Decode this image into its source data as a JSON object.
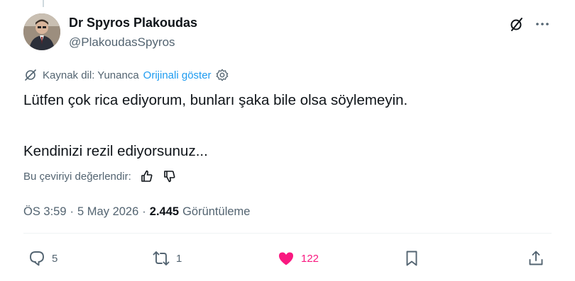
{
  "author": {
    "name": "Dr Spyros Plakoudas",
    "handle": "@PlakoudasSpyros"
  },
  "translation": {
    "source_label": "Kaynak dil: Yunanca",
    "show_original": "Orijinali göster"
  },
  "tweet": {
    "line1": "Lütfen çok rica ediyorum, bunları şaka bile olsa söylemeyin.",
    "line2": "Kendinizi rezil ediyorsunuz..."
  },
  "rate": {
    "label": "Bu çeviriyi değerlendir:"
  },
  "meta": {
    "time": "ÖS 3:59",
    "separator": "·",
    "date": "5 May 2026",
    "views_count": "2.445",
    "views_label": "Görüntüleme"
  },
  "actions": {
    "reply_count": "5",
    "retweet_count": "1",
    "like_count": "122"
  },
  "colors": {
    "text": "#0f1419",
    "muted": "#536471",
    "link": "#1d9bf0",
    "like": "#f91880",
    "divider": "#eff3f4"
  }
}
